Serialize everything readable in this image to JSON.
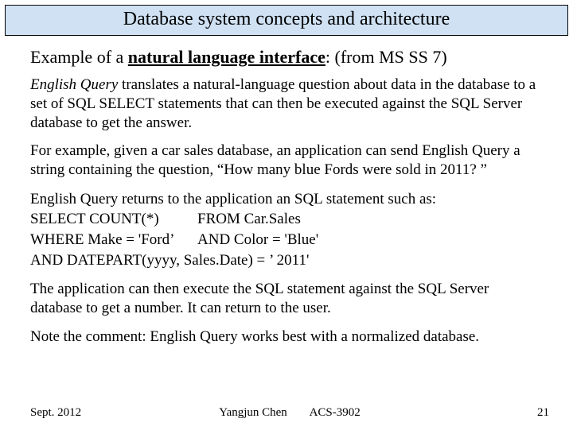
{
  "title": "Database system concepts and architecture",
  "heading": {
    "prefix": "Example of a ",
    "term": "natural language interface",
    "suffix": ": (from MS SS 7)"
  },
  "para1": {
    "lead": "English Query",
    "rest": " translates a natural-language question about data in the database to a set of SQL SELECT statements that can then be executed against the SQL Server database to get the answer."
  },
  "para2": "For example, given a car sales database, an application can send English Query a string containing the question, “How many blue Fords were sold in 2011? ”",
  "sql_intro": "English Query returns to the application an SQL statement such as:",
  "sql": {
    "r1c1": "SELECT COUNT(*)",
    "r1c2": "FROM Car.Sales",
    "r2c1": "WHERE Make = 'Ford’",
    "r2c2": "AND Color = 'Blue'",
    "r3": "AND DATEPART(yyyy, Sales.Date) = ’ 2011'"
  },
  "para3": "The application can then execute the SQL statement against the SQL Server database to get a number. It can return to the user.",
  "para4": "Note the comment: English Query works best with a normalized database.",
  "footer": {
    "date": "Sept. 2012",
    "author": "Yangjun Chen",
    "course": "ACS-3902",
    "page": "21"
  }
}
